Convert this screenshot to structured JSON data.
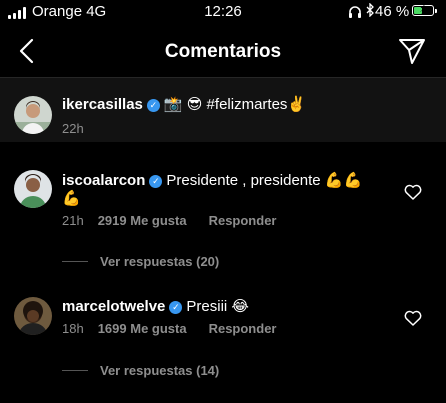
{
  "status_bar": {
    "carrier": "Orange 4G",
    "time": "12:26",
    "battery_percent": "46 %",
    "battery_level": 0.46,
    "battery_color": "#4cd964"
  },
  "header": {
    "title": "Comentarios",
    "back_icon": "chevron-left-icon",
    "send_icon": "paper-plane-icon"
  },
  "caption": {
    "username": "ikercasillas",
    "text": "📸 😎 #felizmartes✌️",
    "time": "22h"
  },
  "comments": [
    {
      "username": "iscoalarcon",
      "text_line1": "Presidente , presidente 💪💪",
      "text_line2": "💪",
      "time": "21h",
      "likes": "2919 Me gusta",
      "reply_label": "Responder",
      "view_replies": "Ver respuestas (20)"
    },
    {
      "username": "marcelotwelve",
      "text_line1": "Presiii 😂",
      "time": "18h",
      "likes": "1699 Me gusta",
      "reply_label": "Responder",
      "view_replies": "Ver respuestas (14)"
    }
  ],
  "colors": {
    "background": "#000000",
    "caption_background": "#121212",
    "verified": "#3897f0",
    "secondary_text": "#8e8e8e"
  }
}
